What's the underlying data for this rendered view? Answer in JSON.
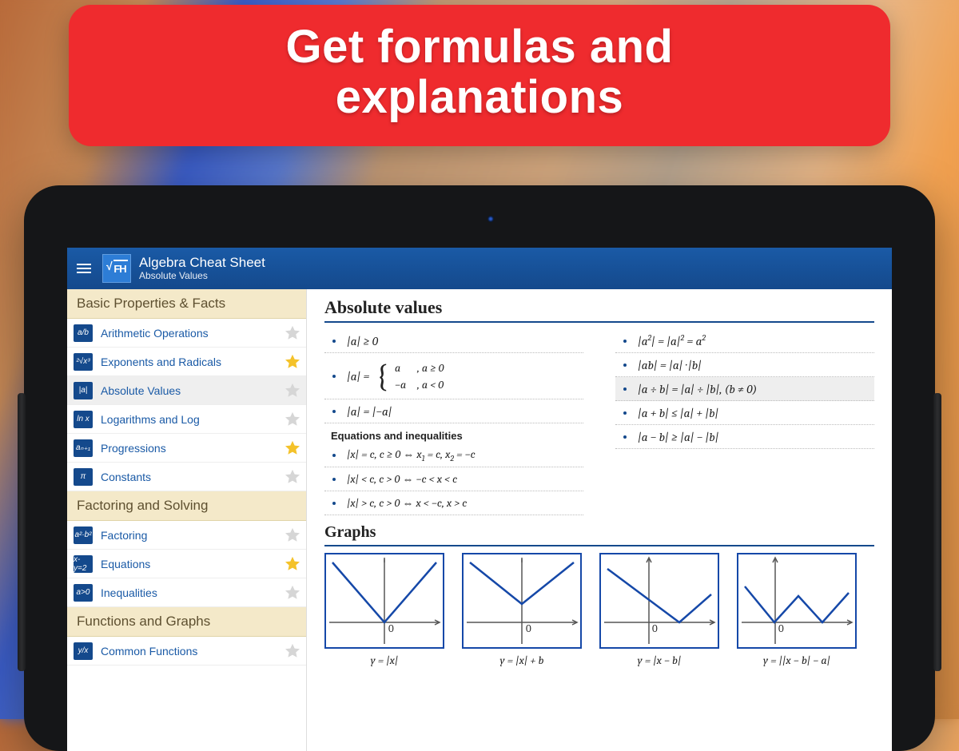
{
  "banner": {
    "line1": "Get formulas and",
    "line2": "explanations"
  },
  "appbar": {
    "logo_text": "FH",
    "title": "Algebra Cheat Sheet",
    "subtitle": "Absolute Values"
  },
  "sidebar": {
    "sections": [
      {
        "title": "Basic Properties & Facts",
        "items": [
          {
            "icon": "a/b",
            "label": "Arithmetic Operations",
            "starred": false,
            "selected": false
          },
          {
            "icon": "²√x³",
            "label": "Exponents and Radicals",
            "starred": true,
            "selected": false
          },
          {
            "icon": "|a|",
            "label": "Absolute Values",
            "starred": false,
            "selected": true
          },
          {
            "icon": "ln x",
            "label": "Logarithms and Log",
            "starred": false,
            "selected": false
          },
          {
            "icon": "aₙ₊₁",
            "label": "Progressions",
            "starred": true,
            "selected": false
          },
          {
            "icon": "π",
            "label": "Constants",
            "starred": false,
            "selected": false
          }
        ]
      },
      {
        "title": "Factoring and Solving",
        "items": [
          {
            "icon": "a²·b²",
            "label": "Factoring",
            "starred": false,
            "selected": false
          },
          {
            "icon": "x-y=2",
            "label": "Equations",
            "starred": true,
            "selected": false
          },
          {
            "icon": "a>0",
            "label": "Inequalities",
            "starred": false,
            "selected": false
          }
        ]
      },
      {
        "title": "Functions and Graphs",
        "items": [
          {
            "icon": "y/x",
            "label": "Common Functions",
            "starred": false,
            "selected": false
          }
        ]
      }
    ]
  },
  "content": {
    "heading": "Absolute values",
    "left_formulas": [
      "|a| ≥ 0",
      "cases",
      "|a| = |−a|"
    ],
    "cases_lhs": "|a| = ",
    "cases": [
      {
        "v": "a",
        "cond": ", a ≥ 0"
      },
      {
        "v": "−a",
        "cond": ", a < 0"
      }
    ],
    "right_formulas": [
      {
        "t": "|a²| = |a|² = a²",
        "hl": false
      },
      {
        "t": "|ab| = |a| · |b|",
        "hl": false
      },
      {
        "t": "|a ÷ b| = |a| ÷ |b|,  (b ≠ 0)",
        "hl": true
      },
      {
        "t": "|a + b| ≤ |a| + |b|",
        "hl": false
      },
      {
        "t": "|a − b| ≥ |a| − |b|",
        "hl": false
      }
    ],
    "subheading": "Equations and inequalities",
    "eq_ineq": [
      "|x| = c, c ≥ 0 ⇔ x₁ = c, x₂ = −c",
      "|x| < c, c > 0 ⇔ −c < x < c",
      "|x| > c, c > 0 ⇔ x < −c, x > c"
    ],
    "graphs_heading": "Graphs",
    "graphs": [
      {
        "label": "y = |x|"
      },
      {
        "label": "y = |x| + b"
      },
      {
        "label": "y = |x − b|"
      },
      {
        "label": "y = ||x − b| − a|"
      }
    ]
  }
}
